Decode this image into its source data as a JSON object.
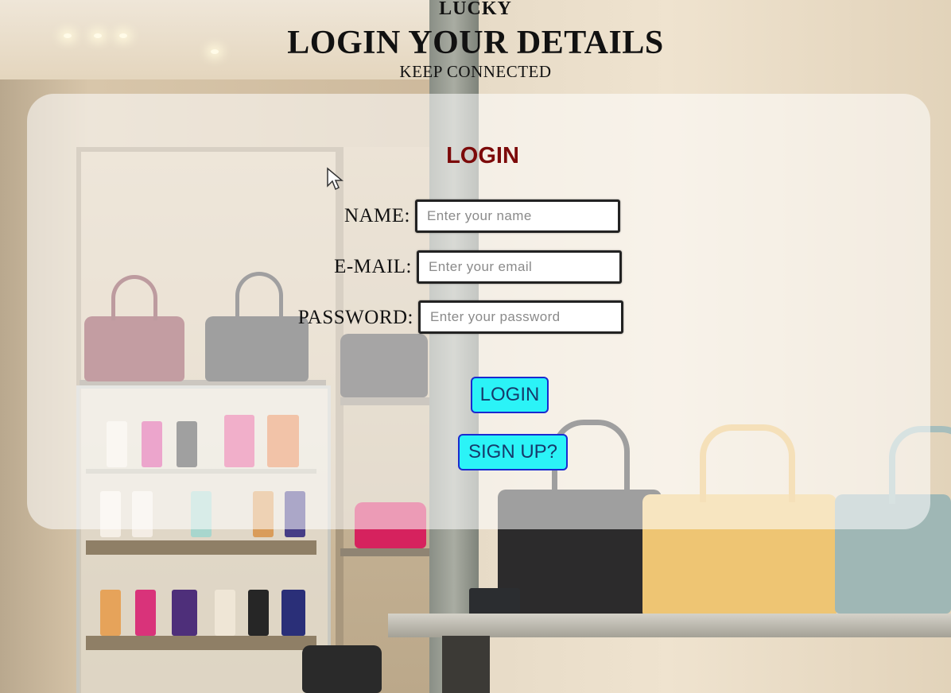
{
  "header": {
    "brand": "LUCKY",
    "title": "LOGIN YOUR DETAILS",
    "subtitle": "KEEP CONNECTED"
  },
  "login_form": {
    "heading": "LOGIN",
    "fields": [
      {
        "label": "NAME:",
        "placeholder": "Enter your name",
        "value": ""
      },
      {
        "label": "E-MAIL:",
        "placeholder": "Enter your email",
        "value": ""
      },
      {
        "label": "PASSWORD:",
        "placeholder": "Enter your password",
        "value": ""
      }
    ],
    "login_button": "LOGIN",
    "signup_button": "SIGN UP?"
  },
  "colors": {
    "heading": "#7c0a0a",
    "button_bg": "#2bf3f7",
    "button_border": "#1a2ad0",
    "button_text": "#163a6b"
  },
  "icons": {
    "cursor": "mouse-pointer-icon"
  }
}
